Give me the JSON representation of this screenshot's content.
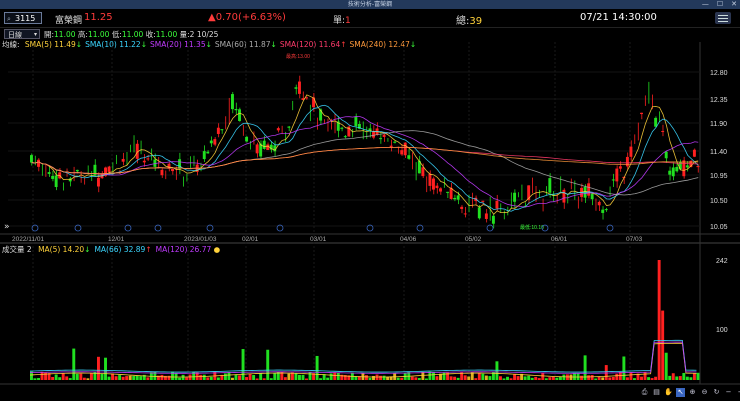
{
  "window": {
    "title": "技術分析-富榮鋼",
    "minimize": "—",
    "maximize": "☐",
    "close": "✕"
  },
  "header": {
    "code": "3115",
    "name": "富榮鋼",
    "price": "11.25",
    "change": "▲0.70(+6.63%)",
    "single_label": "單:",
    "single_value": "1",
    "total_label": "總:",
    "total_value": "39",
    "datetime": "07/21 14:30:00"
  },
  "toolbar_row": {
    "period": "日線",
    "open_label": "開:",
    "open_value": "11.00",
    "high_label": "高:",
    "high_value": "11.00",
    "low_label": "低:",
    "low_value": "11.00",
    "close_label": "收:",
    "close_value": "11.00",
    "volume_label": "量:",
    "volume_value": "2",
    "date": "10/25"
  },
  "ma_legend": {
    "prefix": "均線:",
    "items": [
      {
        "label": "SMA(5) 11.49",
        "arrow": "↓",
        "color": "#ffd23b"
      },
      {
        "label": "SMA(10) 11.22",
        "arrow": "↓",
        "color": "#3bd6ff"
      },
      {
        "label": "SMA(20) 11.35",
        "arrow": "↓",
        "color": "#c03bff"
      },
      {
        "label": "SMA(60) 11.87",
        "arrow": "↓",
        "color": "#aaaaaa"
      },
      {
        "label": "SMA(120) 11.64",
        "arrow": "↑",
        "color": "#ff3b6b"
      },
      {
        "label": "SMA(240) 12.47",
        "arrow": "↓",
        "color": "#ff9a3b"
      }
    ]
  },
  "price_axis": [
    "12.80",
    "12.35",
    "11.90",
    "11.40",
    "10.95",
    "10.50",
    "10.05"
  ],
  "date_axis": [
    "2022/11/01",
    "12/01",
    "2023/01/03",
    "02/01",
    "03/01",
    "04/06",
    "05/02",
    "06/01",
    "07/03"
  ],
  "annotations": {
    "high": "最高:13.00",
    "low": "最低:10.10"
  },
  "volume_legend": {
    "prefix": "成交量",
    "value": "2",
    "items": [
      {
        "label": "MA(5) 14.20",
        "arrow": "↓",
        "color": "#ffd23b"
      },
      {
        "label": "MA(66) 32.89",
        "arrow": "↑",
        "color": "#3bd6ff"
      },
      {
        "label": "MA(120) 26.77",
        "arrow": "",
        "color": "#c03bff"
      }
    ]
  },
  "volume_axis": [
    "242",
    "100"
  ],
  "colors": {
    "up": "#ff2020",
    "down": "#20e020",
    "flat": "#e0b020"
  }
}
